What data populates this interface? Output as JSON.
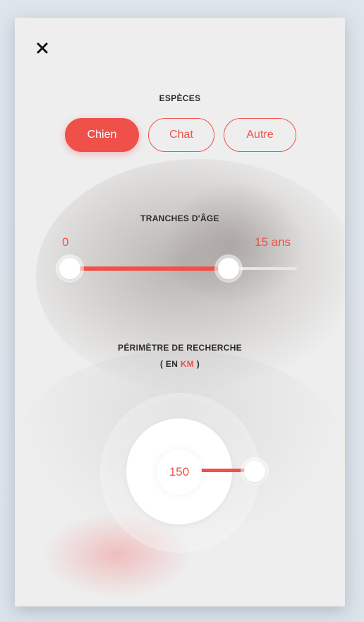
{
  "colors": {
    "accent": "#f0504a",
    "card_background": "#eeeeee",
    "text_dark": "#2b2b2b",
    "track_inactive": "#e6e6e6"
  },
  "header": {
    "close_icon": "close-icon"
  },
  "species": {
    "title": "ESPÈCES",
    "options": [
      {
        "label": "Chien",
        "selected": true
      },
      {
        "label": "Chat",
        "selected": false
      },
      {
        "label": "Autre",
        "selected": false
      }
    ]
  },
  "age": {
    "title": "TRANCHES D'ÂGE",
    "min_label": "0",
    "max_label": "15 ans",
    "selected_fraction": 0.7
  },
  "radius": {
    "title": "PÉRIMÈTRE DE RECHERCHE",
    "subtitle_open": "( EN ",
    "subtitle_unit": "KM",
    "subtitle_close": " )",
    "value": "150"
  }
}
